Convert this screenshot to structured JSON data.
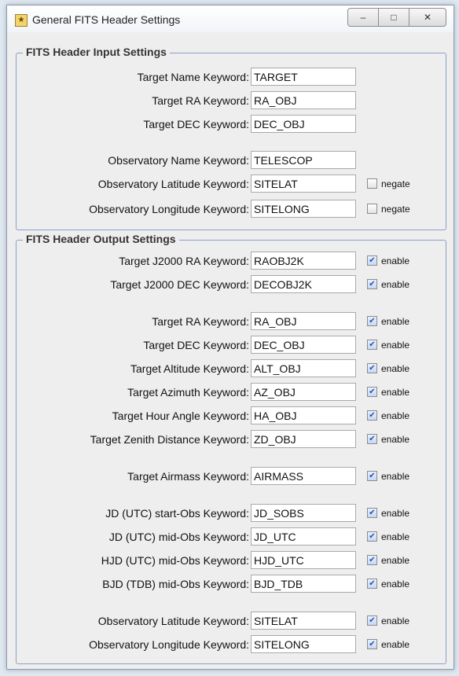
{
  "window": {
    "title": "General FITS Header Settings",
    "minimize_glyph": "–",
    "maximize_glyph": "□",
    "close_glyph": "✕",
    "app_icon": "telescope-icon"
  },
  "input_group": {
    "title": "FITS Header Input Settings",
    "rows": [
      {
        "label": "Target Name Keyword:",
        "value": "TARGET"
      },
      {
        "label": "Target RA Keyword:",
        "value": "RA_OBJ"
      },
      {
        "label": "Target DEC Keyword:",
        "value": "DEC_OBJ"
      },
      {
        "label": "Observatory Name Keyword:",
        "value": "TELESCOP"
      },
      {
        "label": "Observatory Latitude Keyword:",
        "value": "SITELAT",
        "check_label": "negate",
        "checked": false
      },
      {
        "label": "Observatory Longitude Keyword:",
        "value": "SITELONG",
        "check_label": "negate",
        "checked": false
      }
    ]
  },
  "output_group": {
    "title": "FITS Header Output Settings",
    "rows": [
      {
        "label": "Target J2000 RA Keyword:",
        "value": "RAOBJ2K",
        "check_label": "enable",
        "checked": true
      },
      {
        "label": "Target J2000 DEC Keyword:",
        "value": "DECOBJ2K",
        "check_label": "enable",
        "checked": true
      },
      {
        "label": "Target RA Keyword:",
        "value": "RA_OBJ",
        "check_label": "enable",
        "checked": true
      },
      {
        "label": "Target DEC Keyword:",
        "value": "DEC_OBJ",
        "check_label": "enable",
        "checked": true
      },
      {
        "label": "Target Altitude Keyword:",
        "value": "ALT_OBJ",
        "check_label": "enable",
        "checked": true
      },
      {
        "label": "Target Azimuth Keyword:",
        "value": "AZ_OBJ",
        "check_label": "enable",
        "checked": true
      },
      {
        "label": "Target Hour Angle Keyword:",
        "value": "HA_OBJ",
        "check_label": "enable",
        "checked": true
      },
      {
        "label": "Target Zenith Distance Keyword:",
        "value": "ZD_OBJ",
        "check_label": "enable",
        "checked": true
      },
      {
        "label": "Target Airmass Keyword:",
        "value": "AIRMASS",
        "check_label": "enable",
        "checked": true
      },
      {
        "label": "JD (UTC) start-Obs Keyword:",
        "value": "JD_SOBS",
        "check_label": "enable",
        "checked": true
      },
      {
        "label": "JD (UTC) mid-Obs Keyword:",
        "value": "JD_UTC",
        "check_label": "enable",
        "checked": true
      },
      {
        "label": "HJD (UTC) mid-Obs Keyword:",
        "value": "HJD_UTC",
        "check_label": "enable",
        "checked": true
      },
      {
        "label": "BJD (TDB) mid-Obs Keyword:",
        "value": "BJD_TDB",
        "check_label": "enable",
        "checked": true
      },
      {
        "label": "Observatory Latitude Keyword:",
        "value": "SITELAT",
        "check_label": "enable",
        "checked": true
      },
      {
        "label": "Observatory Longitude Keyword:",
        "value": "SITELONG",
        "check_label": "enable",
        "checked": true
      }
    ]
  }
}
